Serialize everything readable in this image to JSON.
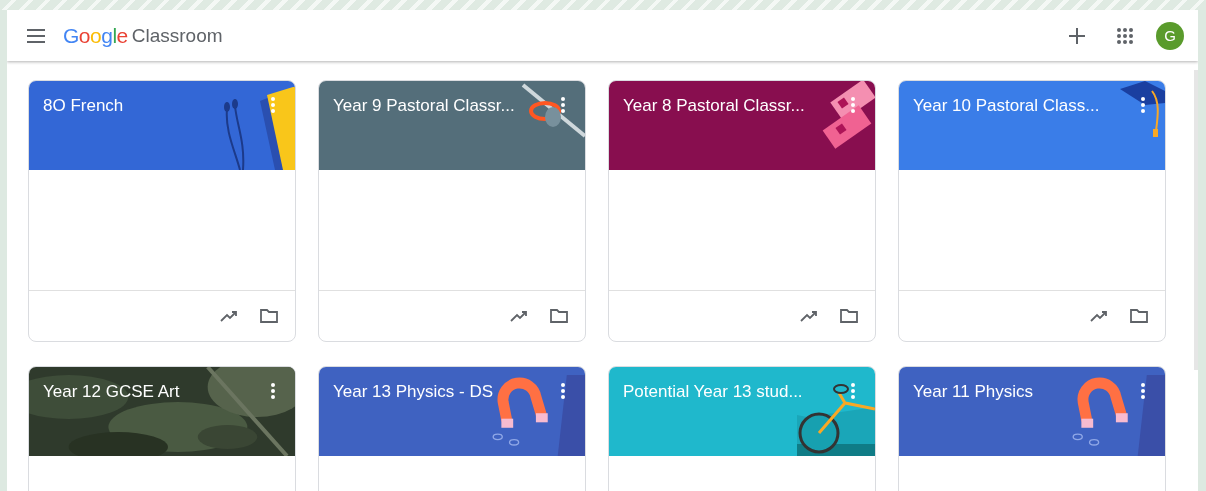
{
  "header": {
    "logo": "Google",
    "product": "Classroom",
    "avatar": "G"
  },
  "classes": [
    {
      "title": "8O French",
      "color": "#3367d6",
      "kind": "earphones"
    },
    {
      "title": "Year 9 Pastoral Classr...",
      "color": "#546e7a",
      "kind": "fencing"
    },
    {
      "title": "Year 8 Pastoral Classr...",
      "color": "#880e4f",
      "kind": "tickets"
    },
    {
      "title": "Year 10 Pastoral Class...",
      "color": "#3a7de8",
      "kind": "cap"
    },
    {
      "title": "Year 12 GCSE Art",
      "kind": "picture"
    },
    {
      "title": "Year 13 Physics - DS",
      "color": "#3f62c1",
      "kind": "magnet"
    },
    {
      "title": "Potential Year 13 stud...",
      "color": "#1fb8cc",
      "kind": "bike"
    },
    {
      "title": "Year 11 Physics",
      "color": "#3f62c1",
      "kind": "magnet"
    }
  ]
}
